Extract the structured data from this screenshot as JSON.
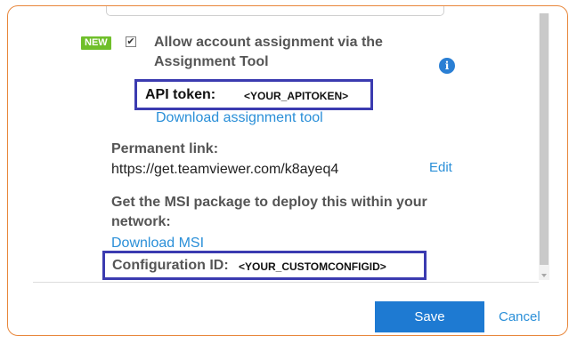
{
  "badge": {
    "new": "NEW"
  },
  "assignment": {
    "checkbox_mark": "✔",
    "checkbox_checked": true,
    "label": "Allow account assignment via the Assignment Tool",
    "info_icon": "info-icon",
    "info_glyph": "i"
  },
  "api_token": {
    "label": "API token:",
    "value": "<YOUR_APITOKEN>"
  },
  "download_tool_link": "Download assignment tool",
  "permanent_link": {
    "label": "Permanent link:",
    "url": "https://get.teamviewer.com/k8ayeq4",
    "edit_label": "Edit"
  },
  "msi": {
    "text": "Get the MSI package to deploy this within your network:",
    "download_label": "Download MSI"
  },
  "config": {
    "label": "Configuration ID:",
    "value": "<YOUR_CUSTOMCONFIGID>"
  },
  "footer": {
    "save_label": "Save",
    "cancel_label": "Cancel"
  },
  "colors": {
    "frame_border": "#e8863a",
    "highlight_box": "#3b3bb0",
    "badge_green": "#6fbf2a",
    "link_blue": "#2a8fd8",
    "save_button": "#1e7ad2"
  }
}
